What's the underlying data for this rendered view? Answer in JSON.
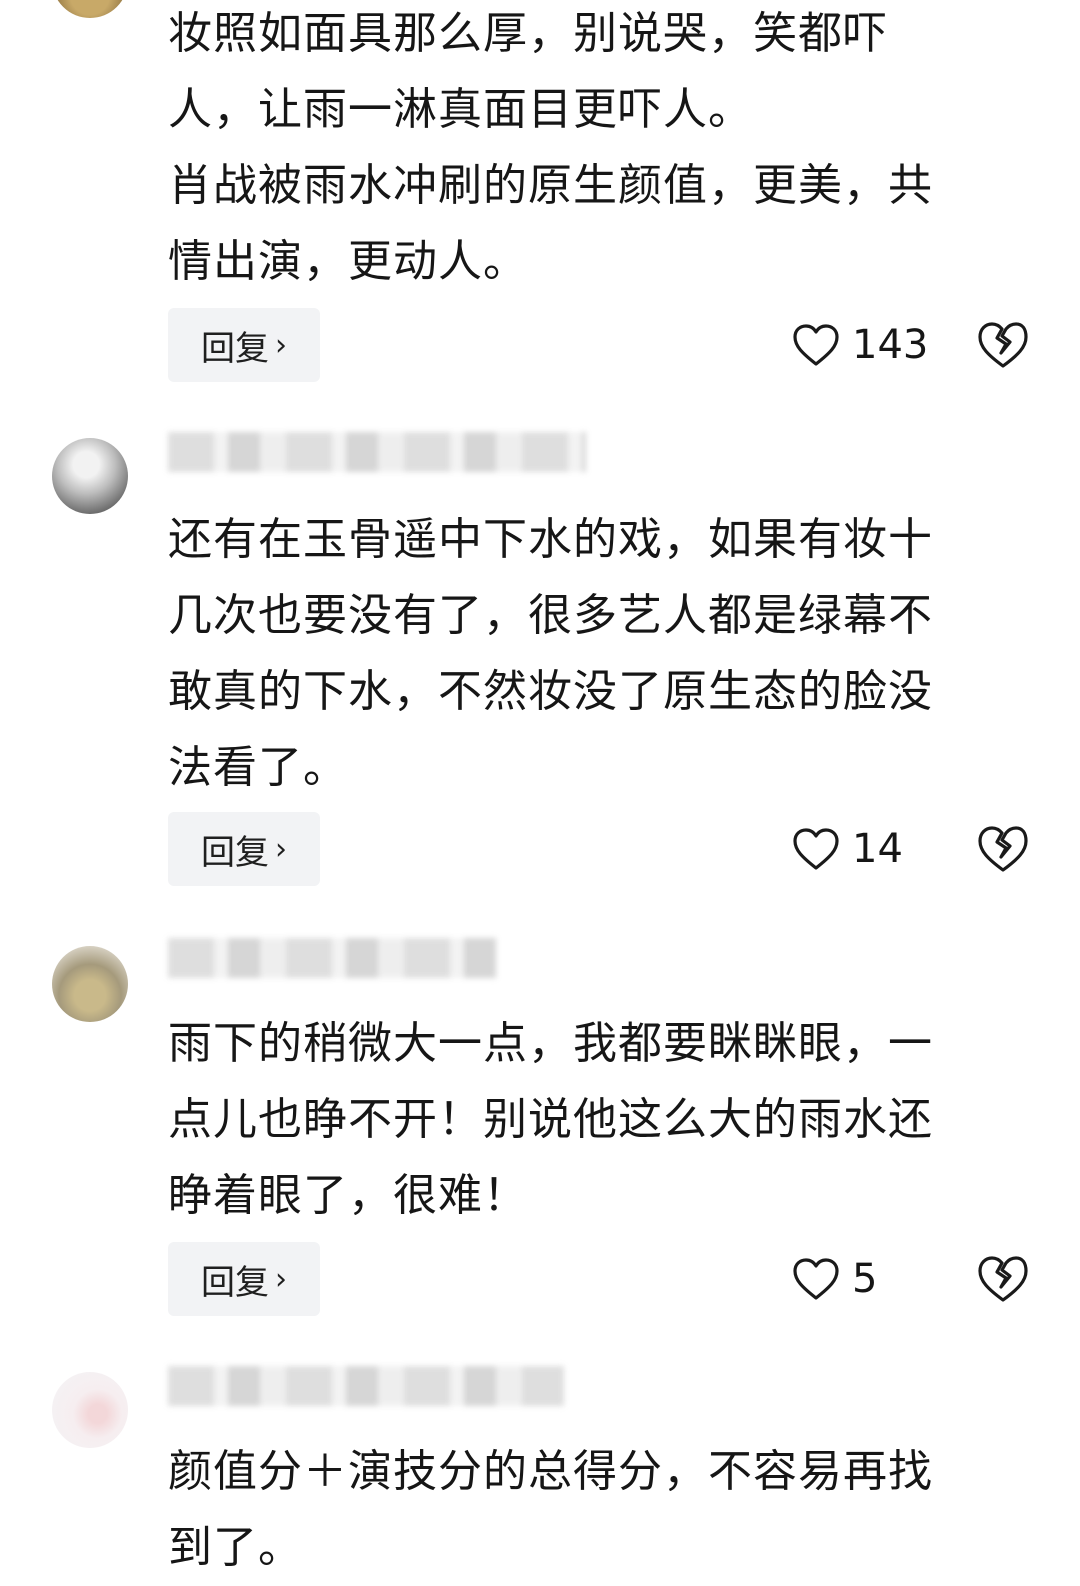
{
  "comments": [
    {
      "text": "妆照如面具那么厚，别说哭，笑都吓\n人，让雨一淋真面目更吓人。\n肖战被雨水冲刷的原生颜值，更美，共\n情出演，更动人。",
      "reply_label": "回复",
      "likes": "143"
    },
    {
      "text": "还有在玉骨遥中下水的戏，如果有妆十\n几次也要没有了，很多艺人都是绿幕不\n敢真的下水，不然妆没了原生态的脸没\n法看了。",
      "reply_label": "回复",
      "likes": "14"
    },
    {
      "text": "雨下的稍微大一点，我都要眯眯眼，一\n点儿也睁不开！别说他这么大的雨水还\n睁着眼了，很难！",
      "reply_label": "回复",
      "likes": "5"
    },
    {
      "text": "颜值分＋演技分的总得分，不容易再找\n到了。"
    }
  ],
  "icons": {
    "chevron": "chevron-right-icon",
    "like": "heart-outline-icon",
    "dislike": "broken-heart-icon"
  }
}
